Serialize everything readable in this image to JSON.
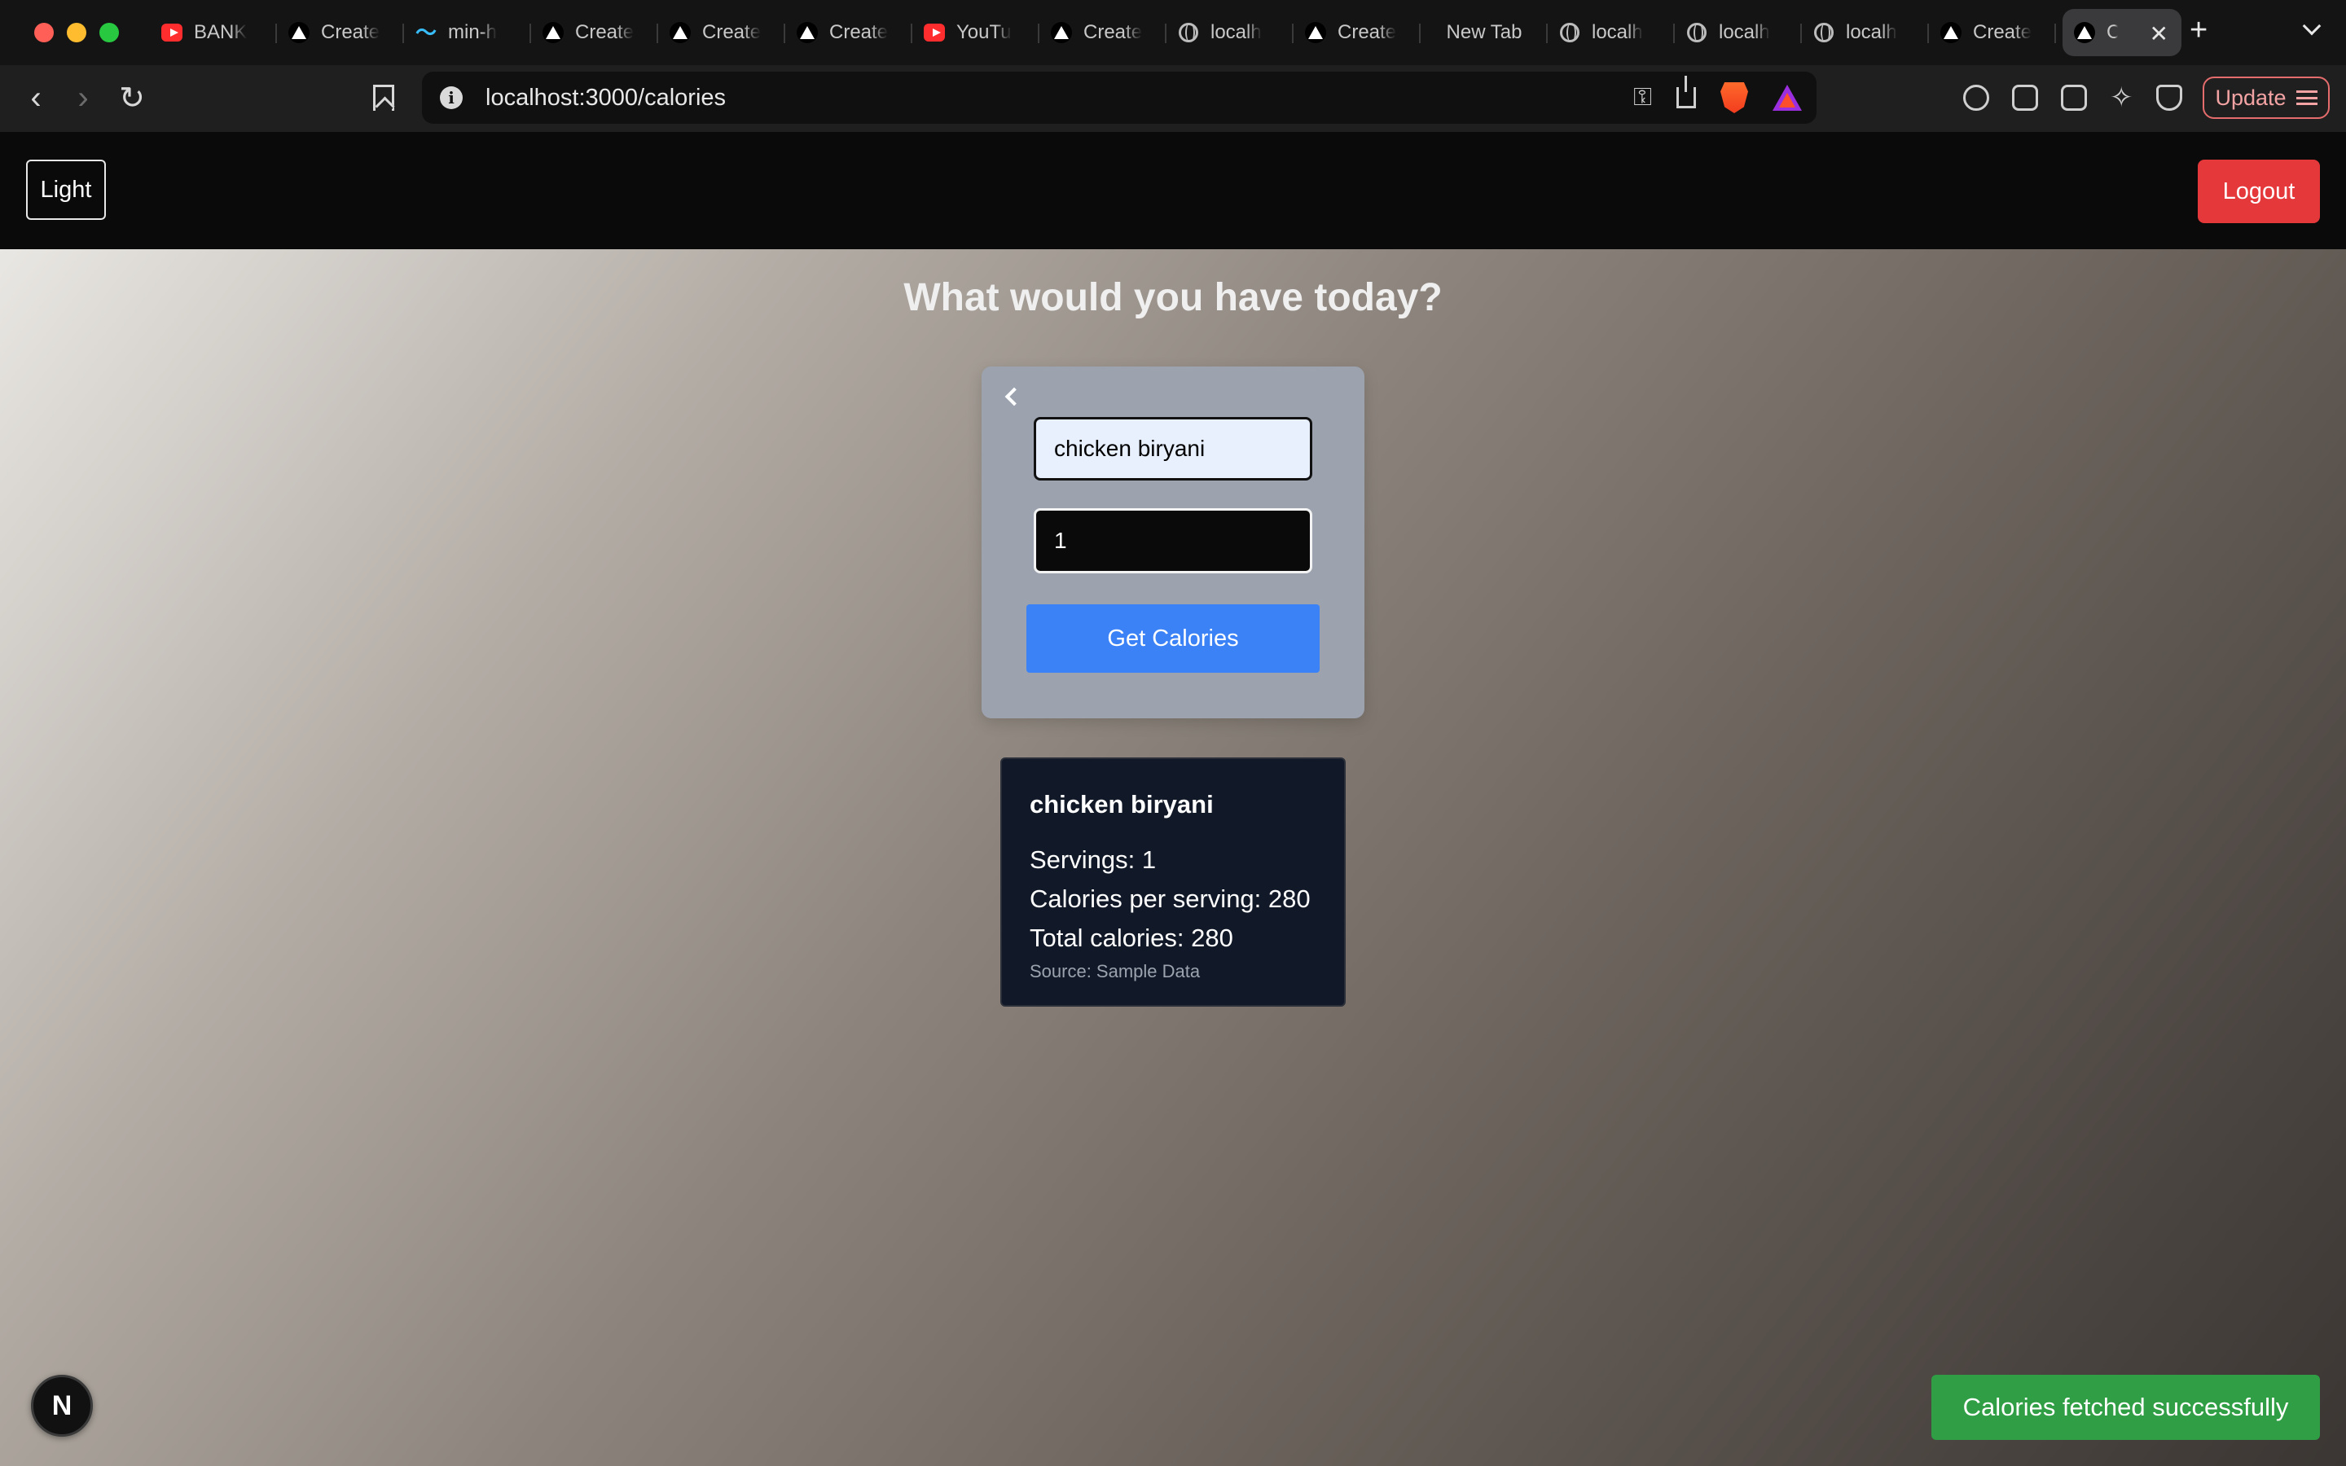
{
  "browser": {
    "tabs": [
      {
        "title": "BANK",
        "icon": "youtube-icon"
      },
      {
        "title": "Create",
        "icon": "vercel-icon"
      },
      {
        "title": "min-h",
        "icon": "tailwind-icon"
      },
      {
        "title": "Create",
        "icon": "vercel-icon"
      },
      {
        "title": "Create",
        "icon": "vercel-icon"
      },
      {
        "title": "Create",
        "icon": "vercel-icon"
      },
      {
        "title": "YouTu",
        "icon": "youtube-icon"
      },
      {
        "title": "Create",
        "icon": "vercel-icon"
      },
      {
        "title": "localh",
        "icon": "globe-icon"
      },
      {
        "title": "Create",
        "icon": "vercel-icon"
      },
      {
        "title": "New Tab",
        "icon": ""
      },
      {
        "title": "localh",
        "icon": "globe-icon"
      },
      {
        "title": "localh",
        "icon": "globe-icon"
      },
      {
        "title": "localh",
        "icon": "globe-icon"
      },
      {
        "title": "Create",
        "icon": "vercel-icon"
      },
      {
        "title": "C",
        "icon": "vercel-icon",
        "active": true
      }
    ],
    "url": "localhost:3000/calories",
    "update_label": "Update"
  },
  "header": {
    "theme_label": "Light",
    "logout_label": "Logout"
  },
  "main": {
    "title": "What would you have today?",
    "form": {
      "food_value": "chicken biryani",
      "servings_value": "1",
      "submit_label": "Get Calories"
    },
    "result": {
      "food": "chicken biryani",
      "servings": "Servings: 1",
      "per_serving": "Calories per serving: 280",
      "total": "Total calories: 280",
      "source": "Source: Sample Data"
    }
  },
  "badge": {
    "label": "N"
  },
  "toast": {
    "message": "Calories fetched successfully"
  },
  "colors": {
    "logout": "#e5383b",
    "submit": "#3b82f6",
    "toast": "#2f9e44",
    "result_bg": "#111827"
  }
}
